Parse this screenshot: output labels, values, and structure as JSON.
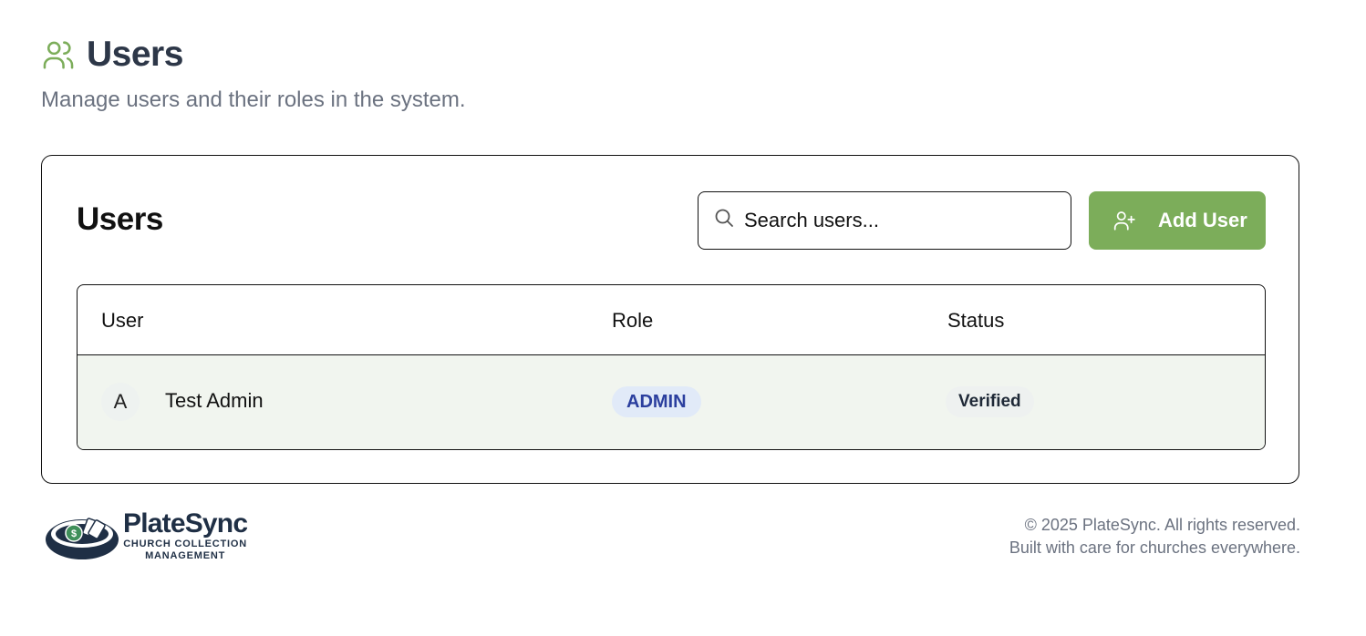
{
  "header": {
    "title": "Users",
    "subtitle": "Manage users and their roles in the system.",
    "icon": "users-icon",
    "icon_color": "#7cad5a"
  },
  "card": {
    "title": "Users",
    "search": {
      "placeholder": "Search users...",
      "value": ""
    },
    "add_button_label": "Add User",
    "add_button_color": "#7cad5a"
  },
  "table": {
    "columns": [
      "User",
      "Role",
      "Status"
    ],
    "rows": [
      {
        "avatar_initial": "A",
        "name": "Test Admin",
        "role": "ADMIN",
        "status": "Verified"
      }
    ]
  },
  "footer": {
    "logo_name": "PlateSync",
    "logo_tagline_line1": "CHURCH COLLECTION",
    "logo_tagline_line2": "MANAGEMENT",
    "copyright": "© 2025 PlateSync. All rights reserved.",
    "tagline": "Built with care for churches everywhere."
  }
}
